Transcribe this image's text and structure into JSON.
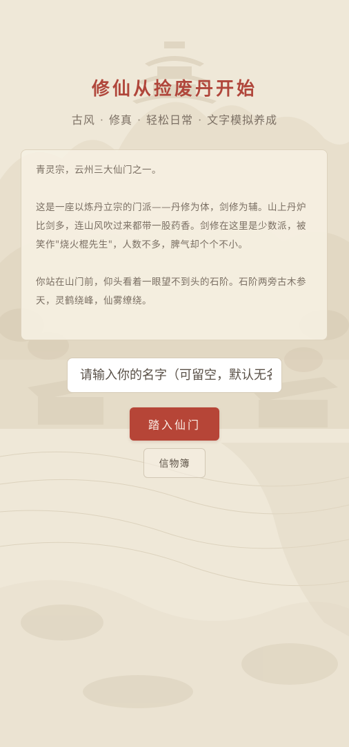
{
  "header": {
    "title": "修仙从捡废丹开始",
    "tags": [
      "古风",
      "修真",
      "轻松日常",
      "文字模拟养成"
    ],
    "separator": "·"
  },
  "story": {
    "paragraphs": [
      "青灵宗，云州三大仙门之一。",
      "这是一座以炼丹立宗的门派——丹修为体，剑修为辅。山上丹炉比剑多，连山风吹过来都带一股药香。剑修在这里是少数派，被笑作\"烧火棍先生\"，人数不多，脾气却个个不小。",
      "你站在山门前，仰头看着一眼望不到头的石阶。石阶两旁古木参天，灵鹤绕峰，仙雾缭绕。"
    ]
  },
  "form": {
    "name_placeholder": "请输入你的名字（可留空，默认无名）",
    "name_value": ""
  },
  "actions": {
    "enter_label": "踏入仙门",
    "token_label": "信物簿"
  },
  "colors": {
    "accent": "#b64537",
    "title": "#b0463b",
    "background": "#efe8d8",
    "card": "#f6f0e2"
  }
}
